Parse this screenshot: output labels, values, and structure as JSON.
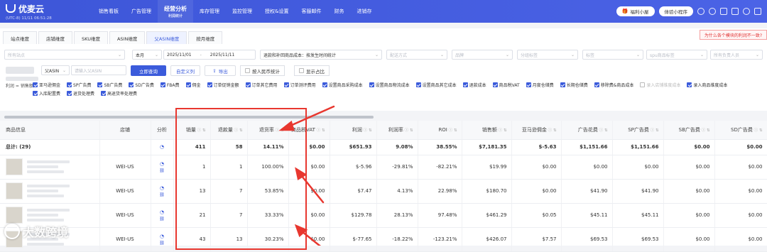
{
  "app": {
    "name": "优麦云",
    "clock": "(UTC-8) 11/11 06:51:28",
    "brand_color": "#3d56d8",
    "accent_red": "#e8372f"
  },
  "nav": {
    "items": [
      {
        "label": "销售看板"
      },
      {
        "label": "广告管理"
      },
      {
        "label": "经营分析",
        "sub": "利润统计",
        "active": true
      },
      {
        "label": "库存管理"
      },
      {
        "label": "监控管理"
      },
      {
        "label": "授权&设置"
      },
      {
        "label": "客服邮件"
      },
      {
        "label": "财务"
      },
      {
        "label": "进销存"
      }
    ],
    "welfare": "福利小屋",
    "miniapp": "体验小程序"
  },
  "tabs": [
    {
      "label": "站点维度"
    },
    {
      "label": "店铺维度"
    },
    {
      "label": "SKU维度"
    },
    {
      "label": "ASIN维度"
    },
    {
      "label": "父ASIN维度",
      "active": true
    },
    {
      "label": "按月维度"
    }
  ],
  "tip": "为什么各个模块的利润不一致?",
  "filters": {
    "site_placeholder": "所有站点",
    "period": "本月",
    "date_start": "2025/11/01",
    "date_end": "2025/11/11",
    "cost_mode": "退款和补回商品成本：按发生时间统计",
    "delivery_placeholder": "配送方式",
    "brand_placeholder": "品牌",
    "category_placeholder": "分组标签",
    "tag_placeholder": "标签",
    "sku_placeholder": "spu商品标签",
    "owner_placeholder": "所有负责人员",
    "asin_type": "父ASIN",
    "asin_input_placeholder": "请输入父ASIN",
    "query_btn": "立即查询",
    "custom_col_btn": "自定义列",
    "export_btn": "导出",
    "rmb_stat": "按人民币统计",
    "show_ratio": "显示占比"
  },
  "profit_formula_label": "利润 = 销售额 -",
  "cost_items": [
    {
      "label": "亚马逊佣金",
      "on": true
    },
    {
      "label": "SP广告费",
      "on": true
    },
    {
      "label": "SB广告费",
      "on": true
    },
    {
      "label": "SD广告费",
      "on": true
    },
    {
      "label": "FBA费",
      "on": true
    },
    {
      "label": "佣金",
      "on": true
    },
    {
      "label": "订单促销金额",
      "on": true
    },
    {
      "label": "订单其它费用",
      "on": true
    },
    {
      "label": "订单测评费用",
      "on": true
    },
    {
      "label": "设置商品采购成本",
      "on": true
    },
    {
      "label": "设置商品物流成本",
      "on": true
    },
    {
      "label": "设置商品其它成本",
      "on": true
    },
    {
      "label": "退款成本",
      "on": true
    },
    {
      "label": "商品税VAT",
      "on": true
    },
    {
      "label": "月度仓储费",
      "on": true
    },
    {
      "label": "长期仓储费",
      "on": true
    },
    {
      "label": "移除费&商品成本",
      "on": true
    },
    {
      "label": "录入店铺维度成本",
      "on": false
    },
    {
      "label": "录入商品维度成本",
      "on": true
    },
    {
      "label": "入库配置费",
      "on": true
    },
    {
      "label": "退货处理费",
      "on": true
    },
    {
      "label": "高退货率处理费",
      "on": true
    }
  ],
  "table": {
    "headers": [
      "商品信息",
      "店铺",
      "分析",
      "销量",
      "退款量",
      "退货率",
      "商品税VAT",
      "利润",
      "利润率",
      "ROI",
      "销售额",
      "亚马逊佣金",
      "广告花费",
      "SP广告费",
      "SB广告费",
      "SD广告费"
    ],
    "total_label": "总计: (29)",
    "total": [
      "411",
      "58",
      "14.11%",
      "$0.00",
      "$651.93",
      "9.08%",
      "38.55%",
      "$7,181.35",
      "$-5.63",
      "$1,151.66",
      "$1,151.66",
      "$0.00",
      "$0.00"
    ],
    "rows": [
      {
        "store": "WEI-US",
        "cells": [
          "1",
          "1",
          "100.00%",
          "$0.00",
          "$-5.96",
          "-29.81%",
          "-82.21%",
          "$19.99",
          "$0.00",
          "$0.00",
          "$0.00",
          "$0.00",
          "$0.00"
        ]
      },
      {
        "store": "WEI-US",
        "cells": [
          "13",
          "7",
          "53.85%",
          "$0.00",
          "$7.47",
          "4.13%",
          "22.98%",
          "$180.70",
          "$0.00",
          "$41.90",
          "$41.90",
          "$0.00",
          "$0.00"
        ]
      },
      {
        "store": "WEI-US",
        "cells": [
          "21",
          "7",
          "33.33%",
          "$0.00",
          "$129.78",
          "28.13%",
          "97.48%",
          "$461.29",
          "$0.05",
          "$45.11",
          "$45.11",
          "$0.00",
          "$0.00"
        ]
      },
      {
        "store": "WEI-US",
        "cells": [
          "43",
          "13",
          "30.23%",
          "$0.00",
          "$-77.65",
          "-18.22%",
          "-123.21%",
          "$426.07",
          "$7.57",
          "$69.53",
          "$69.53",
          "$0.00",
          "$0.00"
        ]
      }
    ]
  },
  "watermark": "大数跨境"
}
